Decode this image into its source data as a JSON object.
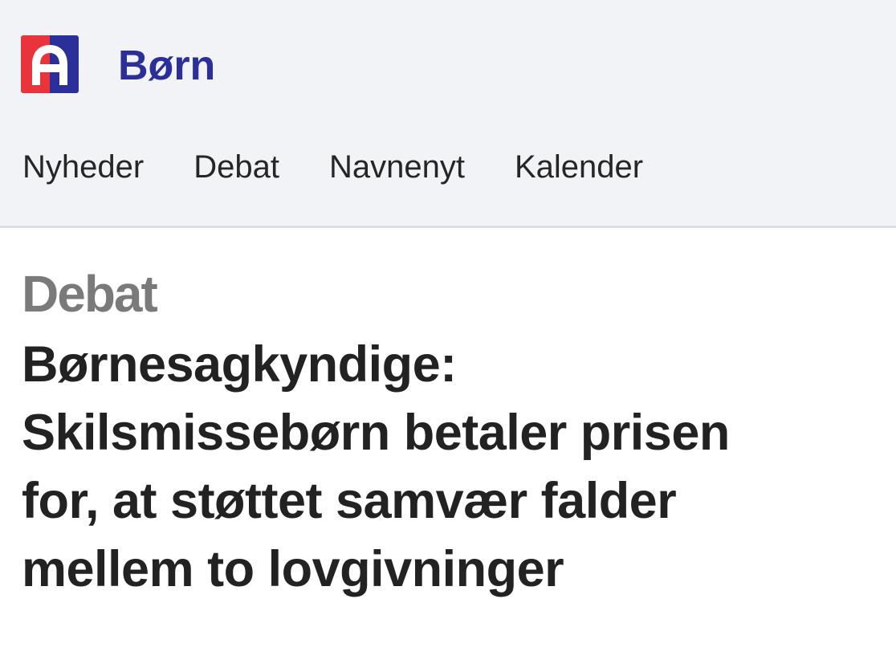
{
  "header": {
    "logo_letter": "A",
    "logo_colors": {
      "left": "#e8343a",
      "right": "#2a2f9a",
      "letter": "#ffffff"
    },
    "section_title": "Børn",
    "section_color": "#2a2f9a"
  },
  "nav": {
    "items": [
      {
        "label": "Nyheder"
      },
      {
        "label": "Debat"
      },
      {
        "label": "Navnenyt"
      },
      {
        "label": "Kalender"
      }
    ]
  },
  "article": {
    "kicker": "Debat",
    "headline_lines": [
      "Børnesagkyndige:",
      "Skilsmissebørn betaler prisen",
      "for, at støttet samvær falder",
      "mellem to lovgivninger"
    ]
  }
}
